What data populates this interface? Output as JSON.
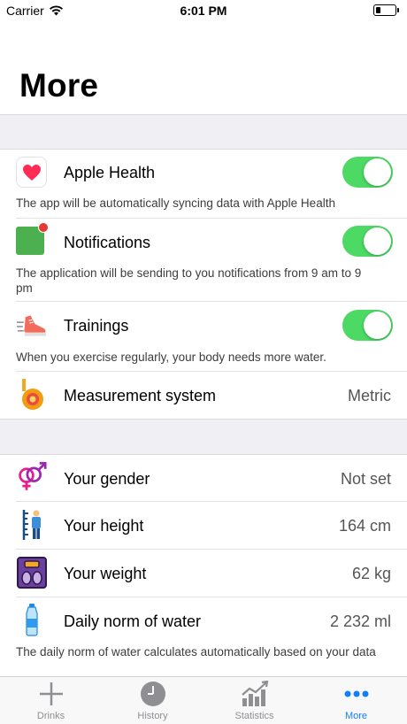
{
  "status_bar": {
    "carrier": "Carrier",
    "time": "6:01 PM"
  },
  "page": {
    "title": "More"
  },
  "settings": {
    "apple_health": {
      "label": "Apple Health",
      "description": "The app will be automatically syncing data with Apple Health",
      "enabled": true
    },
    "notifications": {
      "label": "Notifications",
      "description": "The application will be sending to you notifications from 9 am to 9 pm",
      "enabled": true
    },
    "trainings": {
      "label": "Trainings",
      "description": "When you exercise regularly, your body needs more water.",
      "enabled": true
    },
    "measurement": {
      "label": "Measurement system",
      "value": "Metric"
    }
  },
  "profile": {
    "gender": {
      "label": "Your gender",
      "value": "Not set"
    },
    "height": {
      "label": "Your height",
      "value": "164 cm"
    },
    "weight": {
      "label": "Your weight",
      "value": "62 kg"
    },
    "water": {
      "label": "Daily norm of water",
      "value": "2 232 ml",
      "description": "The daily norm of water calculates automatically based on your data"
    }
  },
  "tabs": [
    {
      "label": "Drinks",
      "icon": "plus-icon"
    },
    {
      "label": "History",
      "icon": "clock-icon"
    },
    {
      "label": "Statistics",
      "icon": "chart-icon"
    },
    {
      "label": "More",
      "icon": "more-dots-icon",
      "active": true
    }
  ],
  "colors": {
    "toggle_on": "#4cd964",
    "accent": "#147efb",
    "section_gap": "#efeff4"
  }
}
